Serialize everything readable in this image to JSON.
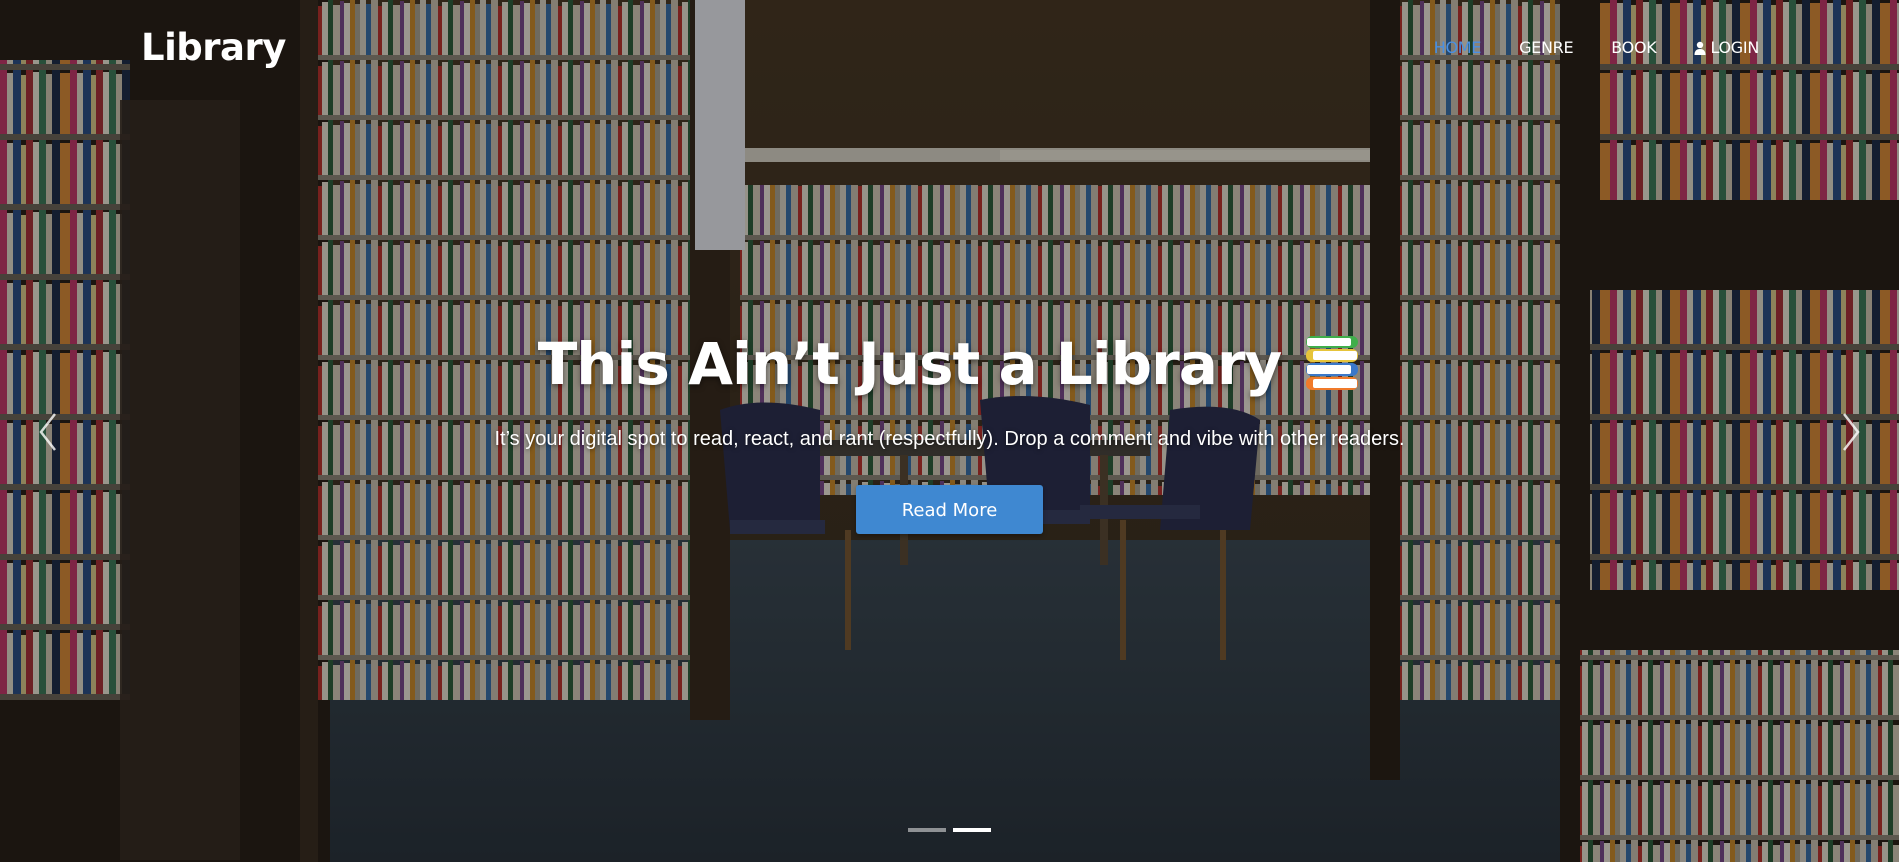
{
  "brand": {
    "name": "Library"
  },
  "nav": {
    "items": [
      {
        "label": "HOME",
        "active": true
      },
      {
        "label": "GENRE",
        "active": false
      },
      {
        "label": "BOOK",
        "active": false
      },
      {
        "label": "LOGIN",
        "active": false,
        "icon": "user-icon"
      }
    ]
  },
  "hero": {
    "headline": "This Ain’t Just a Library",
    "headline_icon": "books-icon",
    "subtext": "It’s your digital spot to read, react, and rant (respectfully). Drop a comment and vibe with other readers.",
    "button_label": "Read More",
    "carousel": {
      "slide_count": 2,
      "active_slide": 2,
      "prev_icon": "chevron-left-icon",
      "next_icon": "chevron-right-icon"
    }
  },
  "colors": {
    "accent": "#3f88d1",
    "nav_active": "#4a90e2",
    "text": "#ffffff"
  }
}
